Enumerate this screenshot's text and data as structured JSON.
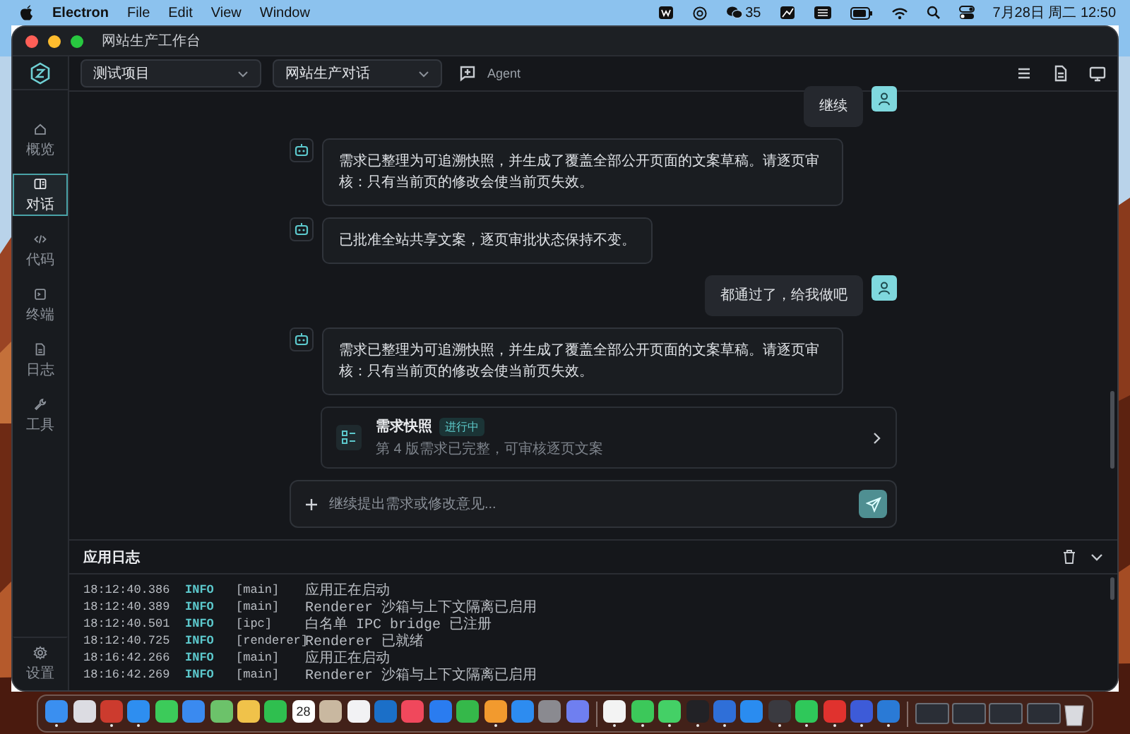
{
  "menubar": {
    "app": "Electron",
    "menus": [
      "File",
      "Edit",
      "View",
      "Window"
    ],
    "wechat_count": "35",
    "clock": "7月28日 周二 12:50"
  },
  "window": {
    "title": "网站生产工作台"
  },
  "toolbar": {
    "project": "测试项目",
    "session": "网站生产对话",
    "mode": "Agent"
  },
  "sidebar": {
    "items": [
      {
        "kind": "home",
        "label": "概览",
        "selected": false
      },
      {
        "kind": "chat",
        "label": "对话",
        "selected": true
      },
      {
        "kind": "code",
        "label": "代码",
        "selected": false
      },
      {
        "kind": "terminal",
        "label": "终端",
        "selected": false
      },
      {
        "kind": "log",
        "label": "日志",
        "selected": false
      },
      {
        "kind": "tools",
        "label": "工具",
        "selected": false
      }
    ],
    "settings": "设置"
  },
  "messages": [
    {
      "kind": "user",
      "text": "继续"
    },
    {
      "kind": "assistant",
      "text": "需求已整理为可追溯快照，并生成了覆盖全部公开页面的文案草稿。请逐页审核：只有当前页的修改会使当前页失效。"
    },
    {
      "kind": "assistant",
      "text": "已批准全站共享文案，逐页审批状态保持不变。"
    },
    {
      "kind": "user",
      "text": "都通过了，给我做吧"
    },
    {
      "kind": "assistant",
      "text": "需求已整理为可追溯快照，并生成了覆盖全部公开页面的文案草稿。请逐页审核：只有当前页的修改会使当前页失效。"
    }
  ],
  "snapshot_card": {
    "title": "需求快照",
    "badge": "进行中",
    "subtitle": "第 4 版需求已完整，可审核逐页文案"
  },
  "composer": {
    "placeholder": "继续提出需求或修改意见..."
  },
  "log": {
    "title": "应用日志",
    "rows": [
      {
        "time": "18:12:40.386",
        "level": "INFO",
        "source": "[main]",
        "message": "应用正在启动"
      },
      {
        "time": "18:12:40.389",
        "level": "INFO",
        "source": "[main]",
        "message": "Renderer 沙箱与上下文隔离已启用"
      },
      {
        "time": "18:12:40.501",
        "level": "INFO",
        "source": "[ipc]",
        "message": "白名单 IPC bridge 已注册"
      },
      {
        "time": "18:12:40.725",
        "level": "INFO",
        "source": "[renderer]",
        "message": "Renderer 已就绪"
      },
      {
        "time": "18:16:42.266",
        "level": "INFO",
        "source": "[main]",
        "message": "应用正在启动"
      },
      {
        "time": "18:16:42.269",
        "level": "INFO",
        "source": "[main]",
        "message": "Renderer 沙箱与上下文隔离已启用"
      }
    ]
  },
  "dock": [
    {
      "kind": "app",
      "color": "#3a8ff0",
      "running": true
    },
    {
      "kind": "app",
      "color": "#dcdce2",
      "running": false
    },
    {
      "kind": "app",
      "color": "#cc3b2e",
      "running": true
    },
    {
      "kind": "app",
      "color": "#2e8ef0",
      "running": true
    },
    {
      "kind": "app",
      "color": "#3ccb5a",
      "running": false
    },
    {
      "kind": "app",
      "color": "#3a8af0",
      "running": false
    },
    {
      "kind": "app",
      "color": "#6cc26a",
      "running": false
    },
    {
      "kind": "app",
      "color": "#f0c24a",
      "running": false
    },
    {
      "kind": "app",
      "color": "#2fbf4f",
      "running": false
    },
    {
      "kind": "calendar",
      "label": "28",
      "running": false
    },
    {
      "kind": "app",
      "color": "#c9b8a0",
      "running": false
    },
    {
      "kind": "app",
      "color": "#f2f2f4",
      "running": false
    },
    {
      "kind": "app",
      "color": "#1b6fc8",
      "running": false
    },
    {
      "kind": "app",
      "color": "#f0485c",
      "running": false
    },
    {
      "kind": "app",
      "color": "#2a7cf0",
      "running": false
    },
    {
      "kind": "app",
      "color": "#35b84a",
      "running": false
    },
    {
      "kind": "app",
      "color": "#f29a2e",
      "running": true
    },
    {
      "kind": "app",
      "color": "#2d8cf0",
      "running": false
    },
    {
      "kind": "app",
      "color": "#8a8a90",
      "running": false
    },
    {
      "kind": "app",
      "color": "#6f7ff0",
      "running": false
    },
    {
      "kind": "separator"
    },
    {
      "kind": "app",
      "color": "#f3f3f3",
      "running": true
    },
    {
      "kind": "app",
      "color": "#3cc85a",
      "running": true
    },
    {
      "kind": "app",
      "color": "#44d066",
      "running": true
    },
    {
      "kind": "app",
      "color": "#222226",
      "running": true
    },
    {
      "kind": "app",
      "color": "#2f6fd8",
      "running": true
    },
    {
      "kind": "app",
      "color": "#2a8cf0",
      "running": false
    },
    {
      "kind": "app",
      "color": "#3a3a40",
      "running": true
    },
    {
      "kind": "app",
      "color": "#2fc85a",
      "running": true
    },
    {
      "kind": "app",
      "color": "#e0322e",
      "running": true
    },
    {
      "kind": "app",
      "color": "#3d5bd8",
      "running": true
    },
    {
      "kind": "app",
      "color": "#2a7ad6",
      "running": true
    },
    {
      "kind": "separator"
    },
    {
      "kind": "window"
    },
    {
      "kind": "window"
    },
    {
      "kind": "window"
    },
    {
      "kind": "window"
    },
    {
      "kind": "trash"
    }
  ]
}
